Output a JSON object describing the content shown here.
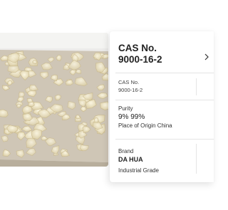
{
  "product_card": {
    "header_label": "CAS No.",
    "header_value": "9000-16-2",
    "icon": "chevron-right-icon"
  },
  "specs": {
    "cas": {
      "label": "CAS No.",
      "value": "9000-16-2"
    },
    "purity": {
      "label": "Purity",
      "value": "9% 99%",
      "origin": "Place of Origin China"
    },
    "brand": {
      "label": "Brand",
      "value": "DA HUA",
      "grade": "Industrial Grade"
    }
  },
  "colors": {
    "card_bg": "#ffffff",
    "text": "#222222",
    "crystal": "#efe6c8",
    "tray": "#c9c1b3"
  }
}
